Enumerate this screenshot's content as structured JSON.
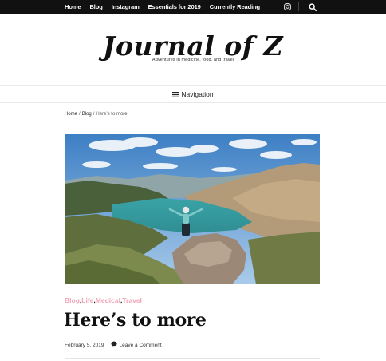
{
  "topbar": {
    "nav": [
      "Home",
      "Blog",
      "Instagram",
      "Essentials for 2019",
      "Currently Reading"
    ],
    "icons": [
      "instagram-icon",
      "search-icon"
    ]
  },
  "site": {
    "title": "Journal of Z",
    "tagline": "Adventures in medicine, food, and travel"
  },
  "navigation": {
    "label": "Navigation",
    "icon": "hamburger-icon"
  },
  "breadcrumb": {
    "items": [
      "Home",
      "Blog",
      "Here’s to more"
    ],
    "separator": "/"
  },
  "post": {
    "categories": [
      "Blog",
      "Life",
      "Medical",
      "Travel"
    ],
    "title": "Here’s to more",
    "date": "February 5, 2019",
    "comment_link": "Leave a Comment"
  },
  "colors": {
    "topbar_bg": "#111111",
    "category_accent": "#f2a5b8"
  }
}
